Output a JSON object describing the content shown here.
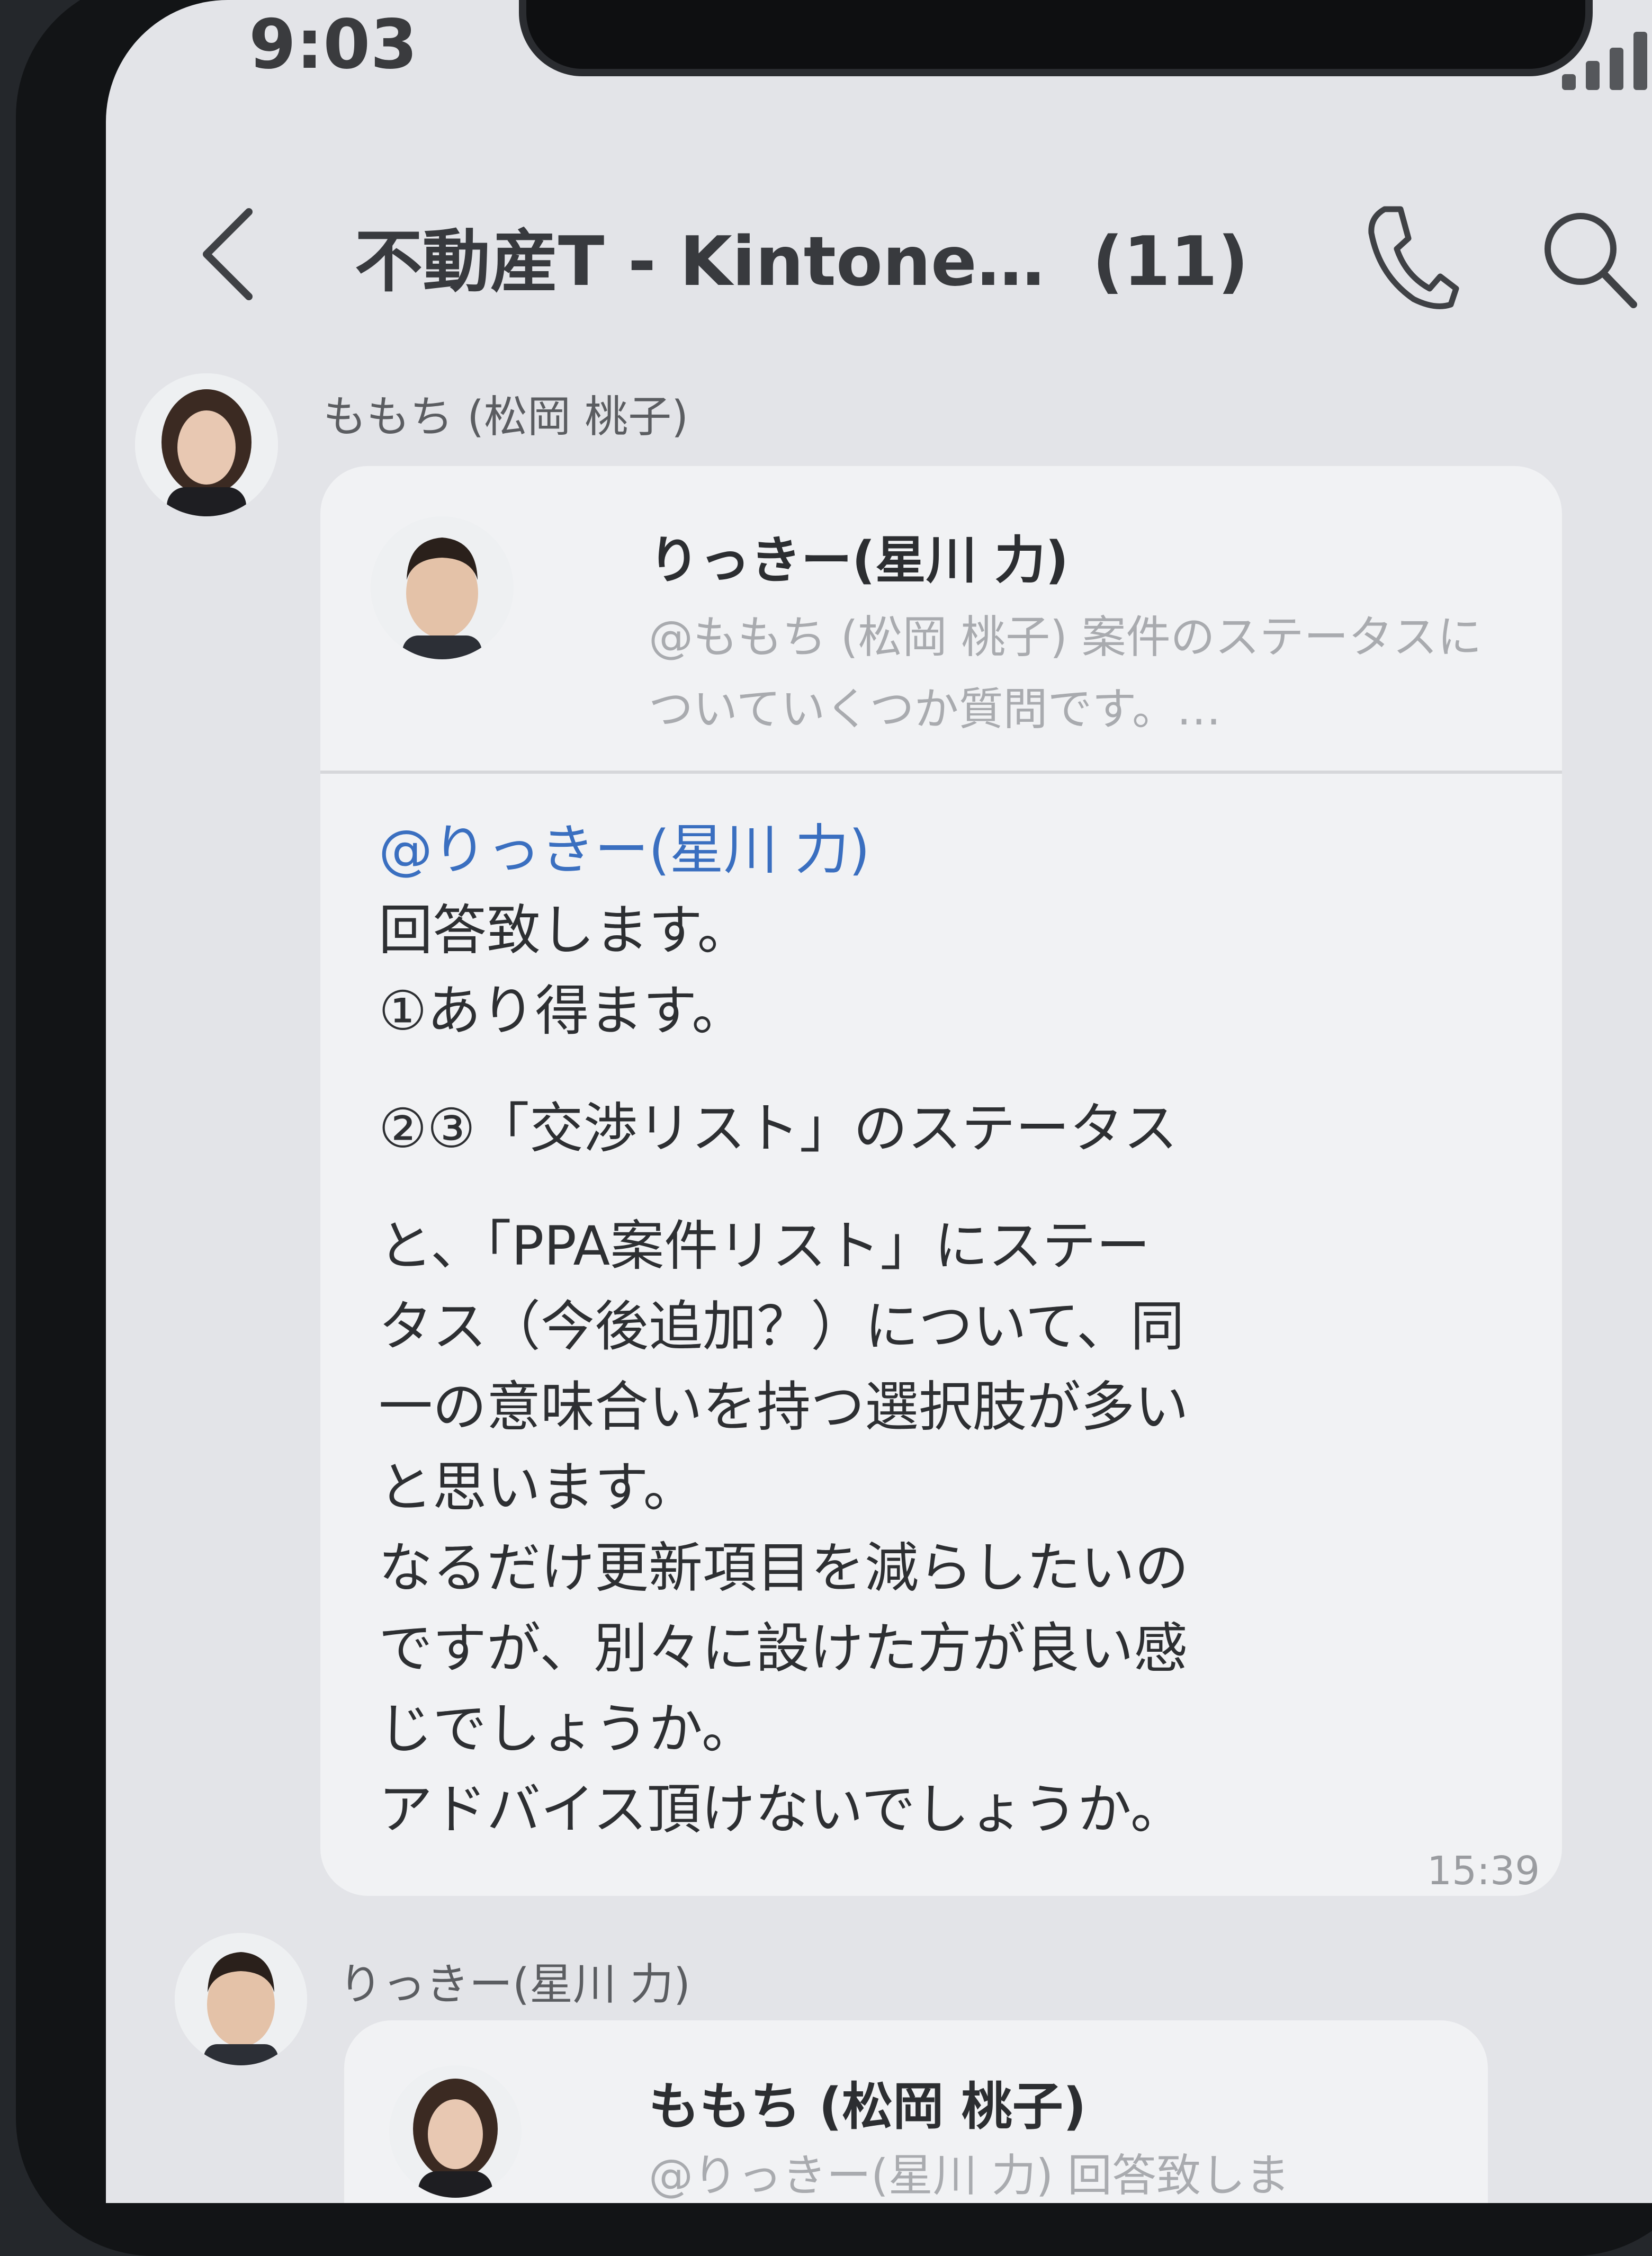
{
  "status_bar": {
    "time": "9:03"
  },
  "header": {
    "title": "不動産T - Kintone…",
    "member_count": "(11)"
  },
  "messages": [
    {
      "sender": "ももち (松岡 桃子)",
      "quote": {
        "name": "りっきー(星川 力)",
        "text": "@ももち (松岡 桃子) 案件のステータスについていくつか質問です。…"
      },
      "mention": "@りっきー(星川 力)",
      "lines": [
        "回答致します。",
        "①あり得ます。",
        "②③「交渉リスト」のステータス",
        "と、「PPA案件リスト」にステー",
        "タス（今後追加？）について、同",
        "一の意味合いを持つ選択肢が多い",
        "と思います。",
        "なるだけ更新項目を減らしたいの",
        "ですが、別々に設けた方が良い感",
        "じでしょうか。",
        "アドバイス頂けないでしょうか。"
      ],
      "time": "15:39"
    },
    {
      "sender": "りっきー(星川 力)",
      "quote": {
        "name": "ももち (松岡 桃子)",
        "text": "@りっきー(星川 力) 回答致しま"
      }
    }
  ],
  "colors": {
    "mention": "#3a6fc0",
    "background": "#e3e4e8",
    "bubble": "#f1f2f4"
  },
  "icons": [
    "back-chevron-icon",
    "phone-icon",
    "search-icon",
    "signal-icon"
  ]
}
